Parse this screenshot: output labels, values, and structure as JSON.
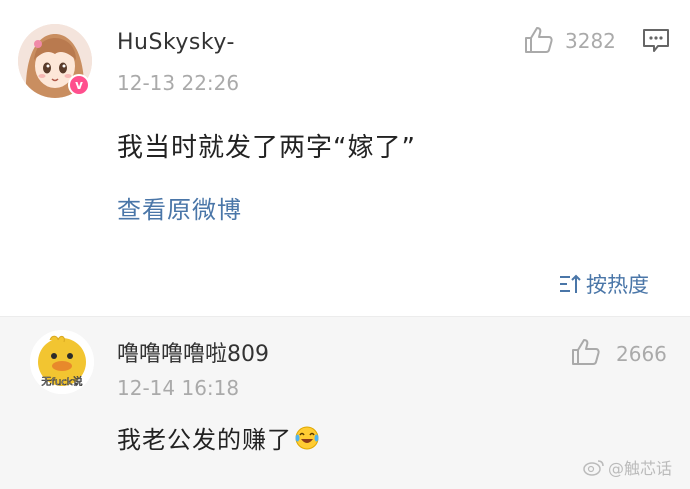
{
  "comments": [
    {
      "username": "HuSkysky-",
      "time": "12-13 22:26",
      "text": "我当时就发了两字“嫁了”",
      "likes": "3282",
      "view_original": "查看原微博",
      "verified_badge": "v",
      "avatar_icon": "anime-girl-avatar-icon"
    },
    {
      "username": "噜噜噜噜啦809",
      "time": "12-14 16:18",
      "text": "我老公发的赚了",
      "likes": "2666",
      "avatar_text": "无fuck说",
      "avatar_icon": "yellow-duck-avatar-icon",
      "emoji": "laughing-tears-emoji"
    }
  ],
  "sort": {
    "label": "按热度"
  },
  "watermark": {
    "text": "@触芯话"
  },
  "colors": {
    "link_blue": "#4a76a8",
    "muted_gray": "#aaaaaa",
    "text_dark": "#222222",
    "badge_pink": "#ff4f8d",
    "reply_bg": "#f6f6f6"
  }
}
